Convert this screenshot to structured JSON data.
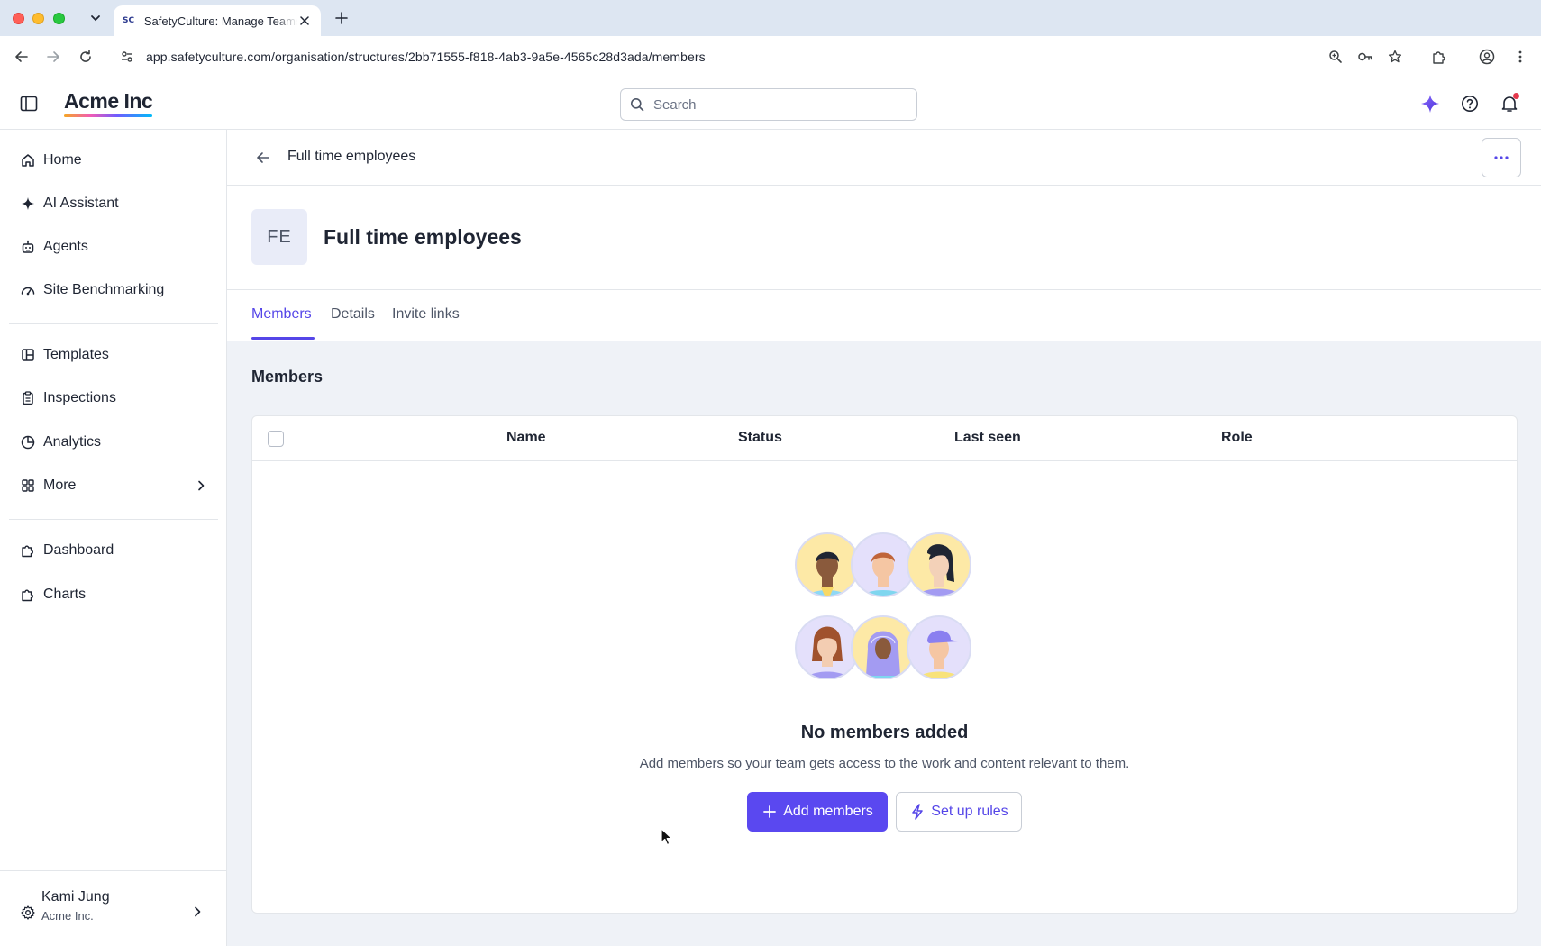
{
  "browser": {
    "tab_title": "SafetyCulture: Manage Teams",
    "tab_favicon": "SC",
    "url": "app.safetyculture.com/organisation/structures/2bb71555-f818-4ab3-9a5e-4565c28d3ada/members"
  },
  "header": {
    "brand": "Acme Inc",
    "search_placeholder": "Search",
    "icons": [
      "sidebar-toggle-icon",
      "search-icon",
      "ai-sparkle-icon",
      "help-icon",
      "bell-icon"
    ],
    "accent_color": "#5a48f0",
    "notification_dot_color": "#e4384c"
  },
  "sidebar": {
    "items": [
      {
        "label": "Home",
        "icon": "home-icon"
      },
      {
        "label": "AI Assistant",
        "icon": "sparkle-icon"
      },
      {
        "label": "Agents",
        "icon": "robot-icon"
      },
      {
        "label": "Site Benchmarking",
        "icon": "gauge-icon"
      },
      {
        "label": "Templates",
        "icon": "template-icon"
      },
      {
        "label": "Inspections",
        "icon": "clipboard-icon"
      },
      {
        "label": "Analytics",
        "icon": "pie-chart-icon"
      },
      {
        "label": "More",
        "icon": "grid-icon"
      },
      {
        "label": "Dashboard",
        "icon": "puzzle-icon"
      },
      {
        "label": "Charts",
        "icon": "puzzle-icon"
      }
    ],
    "user": {
      "name": "Kami Jung",
      "org": "Acme Inc."
    }
  },
  "page": {
    "breadcrumb": "Full time employees",
    "avatar_initials": "FE",
    "title": "Full time employees",
    "tabs": [
      {
        "label": "Members",
        "active": true
      },
      {
        "label": "Details",
        "active": false
      },
      {
        "label": "Invite links",
        "active": false
      }
    ],
    "section_title": "Members",
    "table": {
      "columns": [
        "Name",
        "Status",
        "Last seen",
        "Role"
      ],
      "rows": []
    },
    "empty_state": {
      "title": "No members added",
      "description": "Add members so your team gets access to the work and content relevant to them.",
      "primary_button": "Add members",
      "secondary_button": "Set up rules"
    }
  }
}
